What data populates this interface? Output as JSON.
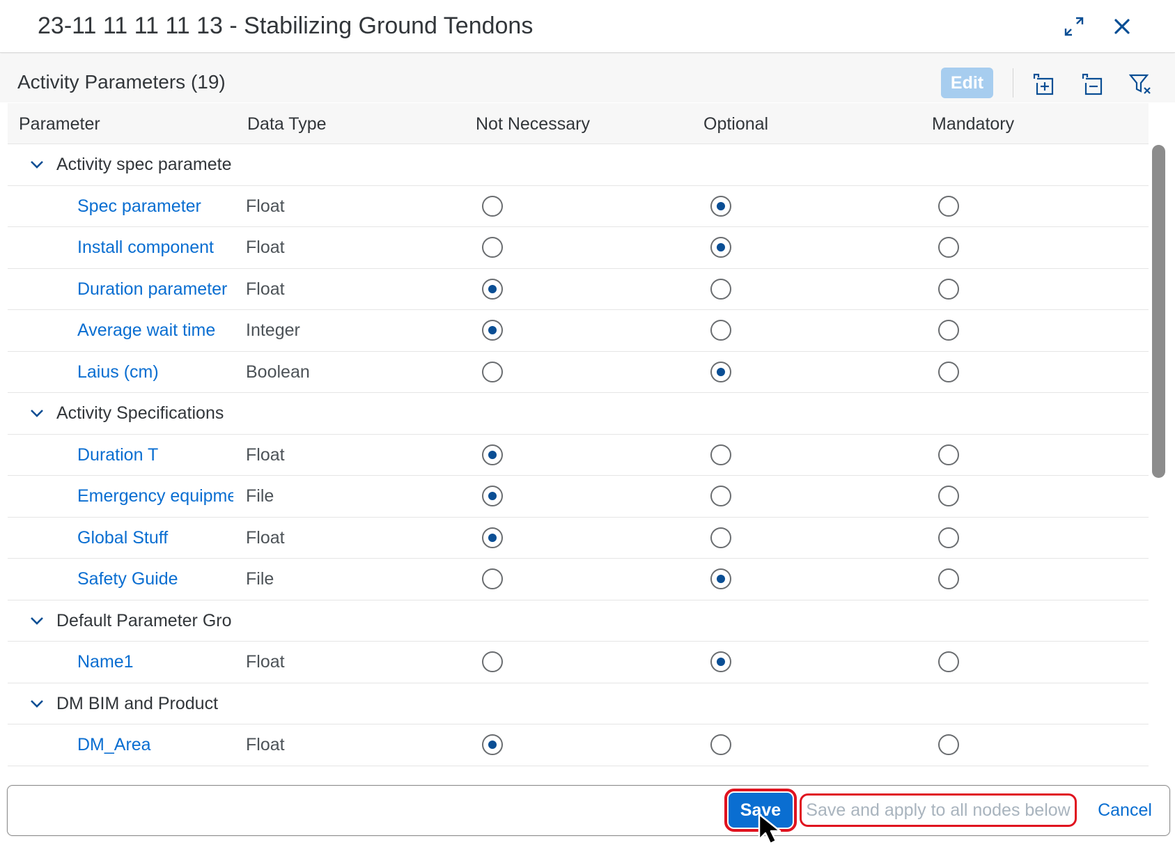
{
  "dialog": {
    "title": "23-11 11 11 11 13 - Stabilizing Ground Tendons",
    "icons": {
      "maximize": "expand-icon",
      "close": "close-icon"
    }
  },
  "toolbar": {
    "section_title": "Activity Parameters (19)",
    "edit_label": "Edit",
    "icons": [
      "expand-all-icon",
      "collapse-all-icon",
      "clear-filter-icon"
    ]
  },
  "table": {
    "columns": [
      "Parameter",
      "Data Type",
      "Not Necessary",
      "Optional",
      "Mandatory"
    ],
    "groups": [
      {
        "label": "Activity spec paramete",
        "params": [
          {
            "name": "Spec parameter",
            "type": "Float",
            "selected": "Optional"
          },
          {
            "name": "Install component",
            "type": "Float",
            "selected": "Optional"
          },
          {
            "name": "Duration parameter",
            "type": "Float",
            "selected": "Not Necessary"
          },
          {
            "name": "Average wait time",
            "type": "Integer",
            "selected": "Not Necessary"
          },
          {
            "name": "Laius (cm)",
            "type": "Boolean",
            "selected": "Optional"
          }
        ]
      },
      {
        "label": "Activity Specifications",
        "params": [
          {
            "name": "Duration T",
            "type": "Float",
            "selected": "Not Necessary"
          },
          {
            "name": "Emergency equipme",
            "type": "File",
            "selected": "Not Necessary"
          },
          {
            "name": "Global Stuff",
            "type": "Float",
            "selected": "Not Necessary"
          },
          {
            "name": "Safety Guide",
            "type": "File",
            "selected": "Optional"
          }
        ]
      },
      {
        "label": "Default Parameter Gro",
        "params": [
          {
            "name": "Name1",
            "type": "Float",
            "selected": "Optional"
          }
        ]
      },
      {
        "label": "DM BIM and Product",
        "params": [
          {
            "name": "DM_Area",
            "type": "Float",
            "selected": "Not Necessary"
          }
        ]
      }
    ]
  },
  "footer": {
    "save_label": "Save",
    "apply_label": "Save and apply to all nodes below",
    "cancel_label": "Cancel"
  },
  "colors": {
    "accent": "#0a6ed1",
    "highlight": "#e0131f",
    "edit_disabled": "#a7cdef"
  }
}
